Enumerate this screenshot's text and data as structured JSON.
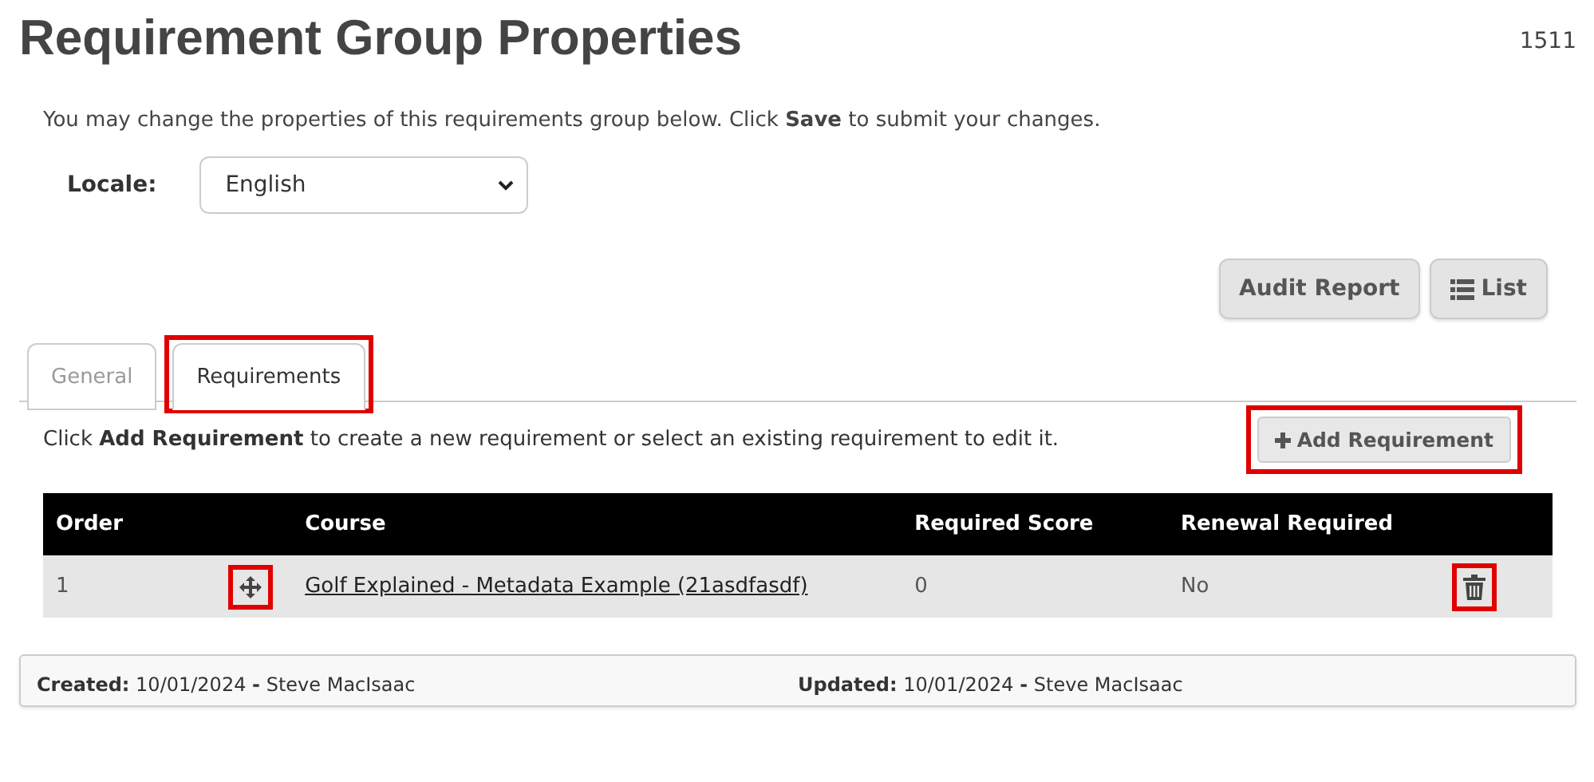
{
  "title": "Requirement Group Properties",
  "record_id": "1511",
  "intro": "You may change the properties of this requirements group below. Click **Save** to submit your changes.",
  "locale": {
    "label": "Locale:",
    "value": "English"
  },
  "actions": [
    {
      "label": "Audit Report",
      "kind": "text"
    },
    {
      "label": "List",
      "kind": "list"
    }
  ],
  "tabs": [
    {
      "label": "General",
      "selected": false,
      "highlighted": false
    },
    {
      "label": "Requirements",
      "selected": true,
      "highlighted": true
    }
  ],
  "instruction": "Click **Add Requirement** to create a new requirement or select an existing requirement to edit it.",
  "add_button": {
    "label": "Add Requirement",
    "highlighted": true
  },
  "table": {
    "columns": [
      "Order",
      "",
      "Course",
      "Required Score",
      "Renewal Required",
      ""
    ],
    "rows": [
      {
        "order": "1",
        "move_highlighted": true,
        "course": "Golf Explained - Metadata Example (21asdfasdf)",
        "required_score": "0",
        "renewal_required": "No",
        "delete_highlighted": true
      }
    ]
  },
  "footer": {
    "created": "**Created:** 10/01/2024 **-** Steve MacIsaac",
    "updated": "**Updated:** 10/01/2024 **-** Steve MacIsaac"
  }
}
